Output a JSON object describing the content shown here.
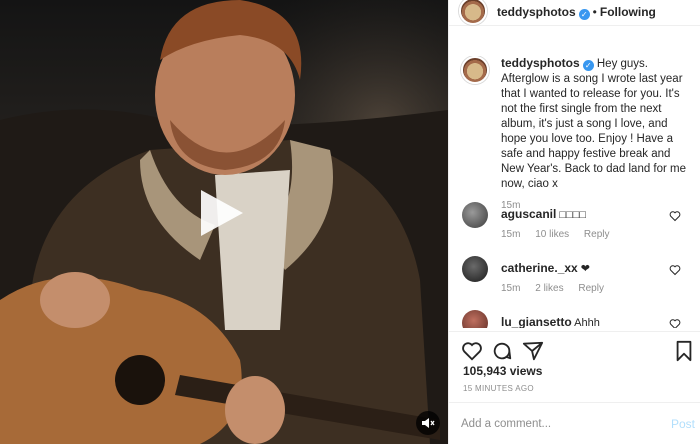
{
  "post": {
    "username": "teddysphotos",
    "follow_label": "Following",
    "caption": "Hey guys. Afterglow is a song I wrote last year that I wanted to release for you. It's not the first single from the next album, it's just a song I love, and hope you love too. Enjoy ! Have a safe and happy festive break and New Year's. Back to dad land for me now, ciao x",
    "caption_time": "15m",
    "views": "105,943 views",
    "posted_ago": "15 MINUTES AGO"
  },
  "comments": [
    {
      "username": "aguscanil",
      "text": "□□□□",
      "time": "15m",
      "likes": "10 likes",
      "reply": "Reply"
    },
    {
      "username": "catherine._xx",
      "text": "❤",
      "time": "15m",
      "likes": "2 likes",
      "reply": "Reply"
    },
    {
      "username": "lu_giansetto",
      "text": "Ahhh"
    }
  ],
  "composer": {
    "placeholder": "Add a comment...",
    "post_label": "Post"
  },
  "icons": {
    "verified": "verified-badge",
    "play": "play-icon",
    "mute": "speaker-muted-icon",
    "like": "heart-icon",
    "comment": "comment-icon",
    "share": "share-icon",
    "save": "bookmark-icon"
  },
  "colors": {
    "verified_blue": "#3897f0",
    "post_disabled": "#b2dffc",
    "muted_text": "#8e8e8e"
  }
}
